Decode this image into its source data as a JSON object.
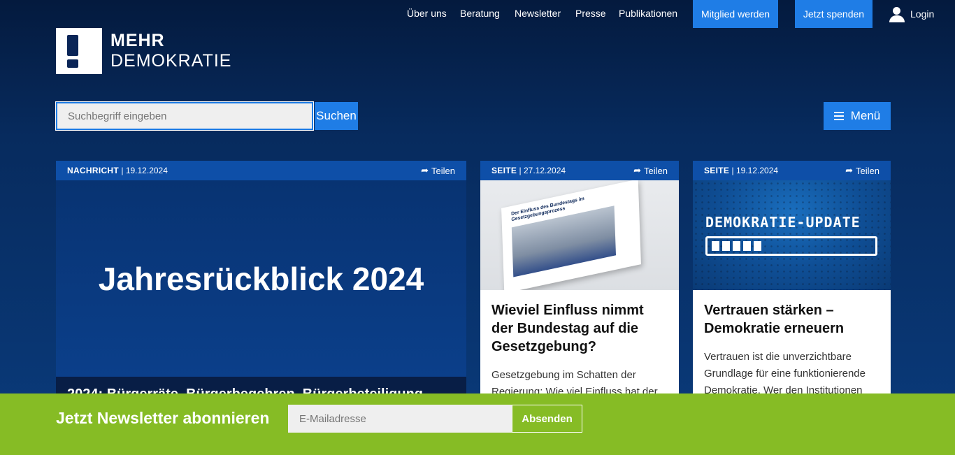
{
  "topnav": {
    "links": [
      "Über uns",
      "Beratung",
      "Newsletter",
      "Presse",
      "Publikationen"
    ],
    "member_label": "Mitglied werden",
    "donate_label": "Jetzt spenden",
    "login_label": "Login"
  },
  "logo": {
    "line1": "MEHR",
    "line2": "DEMOKRATIE"
  },
  "search": {
    "placeholder": "Suchbegriff eingeben",
    "button_label": "Suchen"
  },
  "menu": {
    "label": "Menü"
  },
  "cards": [
    {
      "type": "NACHRICHT",
      "date": "| 19.12.2024",
      "share_label": "Teilen",
      "image_title": "Jahresrückblick 2024",
      "headline": "2024: Bürgerräte, Bürgerbegehren, Bürgerbeteiligung"
    },
    {
      "type": "SEITE",
      "date": "| 27.12.2024",
      "share_label": "Teilen",
      "image_text": "Der Einfluss des Bundestags im Gesetzgebungsprozess",
      "headline": "Wieviel Einfluss nimmt der Bundestag auf die Gesetzgebung?",
      "teaser": "Gesetzgebung im Schatten der Regierung: Wie viel Einfluss hat der"
    },
    {
      "type": "SEITE",
      "date": "| 19.12.2024",
      "share_label": "Teilen",
      "image_text": "DEMOKRATIE-UPDATE",
      "headline": "Vertrauen stärken – Demokratie erneuern",
      "teaser": "Vertrauen ist die unverzichtbare Grundlage für eine funktionierende Demokratie. Wer den Institutionen"
    }
  ],
  "newsletter": {
    "title": "Jetzt Newsletter abonnieren",
    "placeholder": "E-Mailadresse",
    "button_label": "Absenden"
  }
}
